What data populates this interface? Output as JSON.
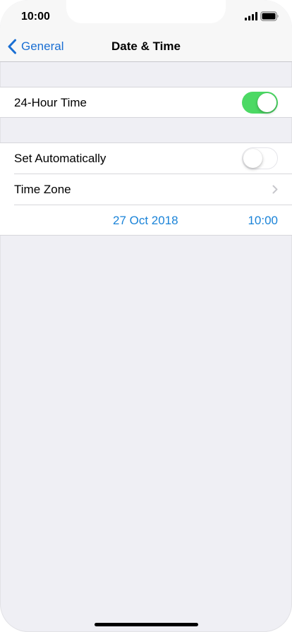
{
  "status_bar": {
    "time": "10:00",
    "signal_icon": "cellular-signal-icon",
    "battery_icon": "battery-icon"
  },
  "nav": {
    "back_label": "General",
    "back_icon": "chevron-left-icon",
    "title": "Date & Time"
  },
  "settings": {
    "twenty_four_hour": {
      "label": "24-Hour Time",
      "enabled": true
    },
    "set_automatically": {
      "label": "Set Automatically",
      "enabled": false
    },
    "time_zone": {
      "label": "Time Zone",
      "icon": "chevron-right-icon"
    },
    "date_time": {
      "date": "27 Oct 2018",
      "time": "10:00"
    }
  },
  "colors": {
    "accent": "#1a83d8",
    "toggle_on": "#4cd964",
    "background": "#efeff4"
  }
}
